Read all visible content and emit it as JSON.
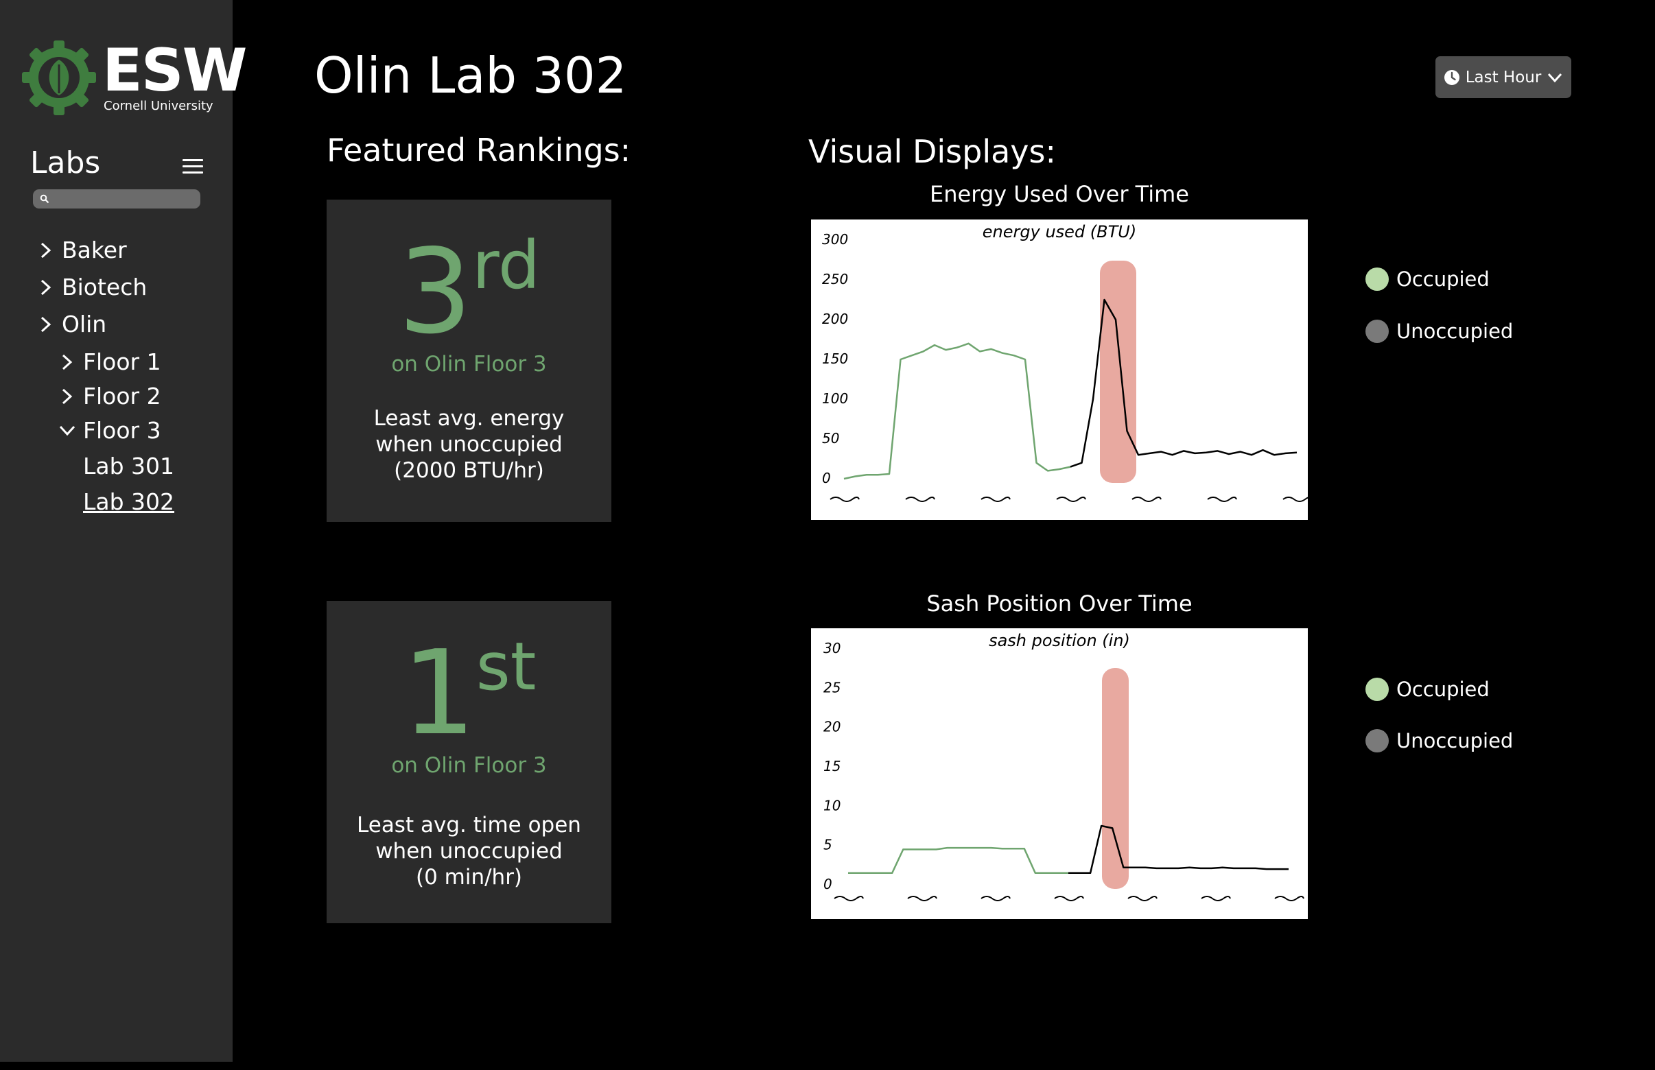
{
  "sidebar": {
    "logo_text": "ESW",
    "logo_subtitle": "Cornell University",
    "heading": "Labs",
    "search": {
      "placeholder": "",
      "value": ""
    },
    "tree": [
      {
        "label": "Baker",
        "expanded": false
      },
      {
        "label": "Biotech",
        "expanded": false
      },
      {
        "label": "Olin",
        "expanded": true
      },
      {
        "label": "Floor 1",
        "expanded": false
      },
      {
        "label": "Floor 2",
        "expanded": false
      },
      {
        "label": "Floor 3",
        "expanded": true
      }
    ],
    "labs": [
      {
        "label": "Lab 301",
        "active": false
      },
      {
        "label": "Lab 302",
        "active": true
      }
    ]
  },
  "header": {
    "title": "Olin Lab 302",
    "time_range": "Last Hour"
  },
  "rankings": {
    "heading": "Featured Rankings:",
    "cards": [
      {
        "rank_number": "3",
        "rank_suffix": "rd",
        "scope": "on Olin Floor 3",
        "desc_line1": "Least  avg. energy",
        "desc_line2": "when unoccupied",
        "desc_line3": "(2000 BTU/hr)"
      },
      {
        "rank_number": "1",
        "rank_suffix": "st",
        "scope": "on Olin Floor 3",
        "desc_line1": "Least avg. time open",
        "desc_line2": "when unoccupied",
        "desc_line3": "(0 min/hr)"
      }
    ]
  },
  "visuals": {
    "heading": "Visual Displays:",
    "charts": [
      {
        "title": "Energy Used Over Time",
        "legend_occupied": "Occupied",
        "legend_unoccupied": "Unoccupied"
      },
      {
        "title": "Sash Position Over Time",
        "legend_occupied": "Occupied",
        "legend_unoccupied": "Unoccupied"
      }
    ]
  },
  "colors": {
    "accent_green": "#6fa56f",
    "occupied": "#b9dba8",
    "unoccupied": "#7a7a7a",
    "highlight": "#e8a9a0"
  },
  "chart_data": [
    {
      "type": "line",
      "title": "energy used (BTU)",
      "ylim": [
        0,
        300
      ],
      "yticks": [
        "300",
        "250",
        "200",
        "150",
        "100",
        "50",
        "0"
      ],
      "series": [
        {
          "name": "Occupied",
          "color": "#6fa56f",
          "x": [
            0,
            1,
            2,
            3,
            4,
            5,
            6,
            7,
            8,
            9,
            10,
            11,
            12,
            13,
            14,
            15,
            16,
            17,
            18,
            19,
            20
          ],
          "y": [
            0,
            3,
            5,
            5,
            6,
            150,
            155,
            160,
            168,
            162,
            165,
            170,
            160,
            163,
            158,
            155,
            150,
            20,
            10,
            12,
            15
          ]
        },
        {
          "name": "Unoccupied",
          "color": "#000000",
          "x": [
            20,
            21,
            22,
            23,
            24,
            25,
            26,
            27,
            28,
            29,
            30,
            31,
            32,
            33,
            34,
            35,
            36,
            37,
            38,
            39,
            40
          ],
          "y": [
            15,
            20,
            100,
            225,
            200,
            60,
            30,
            32,
            34,
            30,
            35,
            32,
            33,
            35,
            31,
            34,
            30,
            36,
            30,
            32,
            33
          ]
        }
      ]
    },
    {
      "type": "line",
      "title": "sash position (in)",
      "ylim": [
        0,
        30
      ],
      "yticks": [
        "30",
        "25",
        "20",
        "15",
        "10",
        "5",
        "0"
      ],
      "series": [
        {
          "name": "Occupied",
          "color": "#6fa56f",
          "x": [
            0,
            1,
            2,
            3,
            4,
            5,
            6,
            7,
            8,
            9,
            10,
            11,
            12,
            13,
            14,
            15,
            16,
            17,
            18,
            19,
            20
          ],
          "y": [
            1.5,
            1.5,
            1.5,
            1.5,
            1.5,
            4.5,
            4.5,
            4.5,
            4.5,
            4.7,
            4.7,
            4.7,
            4.7,
            4.7,
            4.6,
            4.6,
            4.6,
            1.5,
            1.5,
            1.5,
            1.5
          ]
        },
        {
          "name": "Unoccupied",
          "color": "#000000",
          "x": [
            20,
            21,
            22,
            23,
            24,
            25,
            26,
            27,
            28,
            29,
            30,
            31,
            32,
            33,
            34,
            35,
            36,
            37,
            38,
            39,
            40
          ],
          "y": [
            1.5,
            1.5,
            1.5,
            7.5,
            7.2,
            2.2,
            2.2,
            2.2,
            2.1,
            2.1,
            2.1,
            2.2,
            2.1,
            2.1,
            2.2,
            2.1,
            2.1,
            2.1,
            2.0,
            2.0,
            2.0
          ]
        }
      ]
    }
  ]
}
